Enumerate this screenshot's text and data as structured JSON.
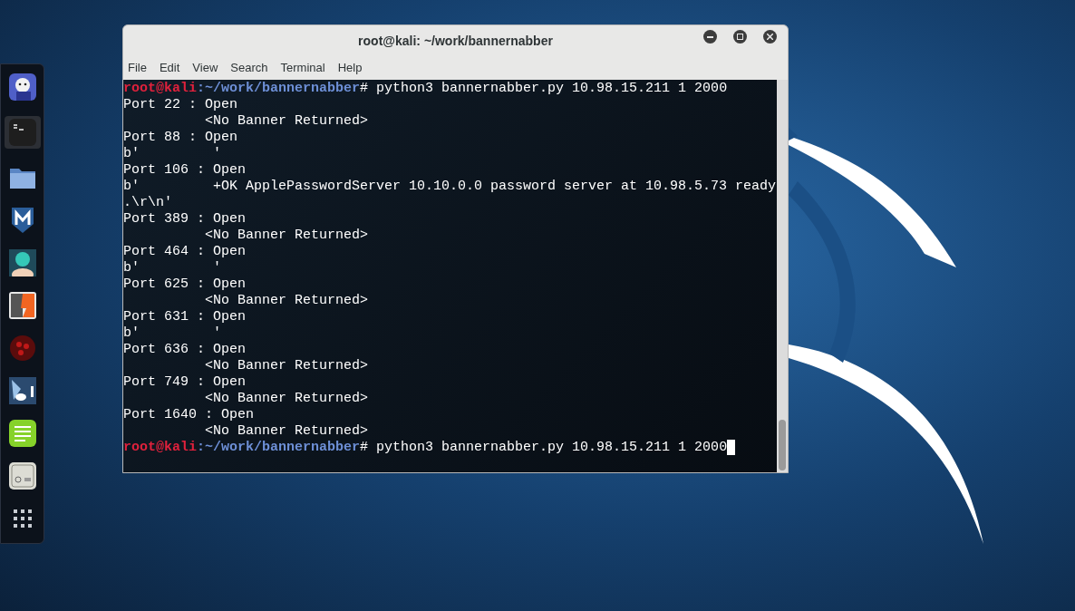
{
  "dock": [
    {
      "kind": "mascot",
      "selected": false
    },
    {
      "kind": "terminal",
      "selected": true
    },
    {
      "kind": "folder",
      "selected": false
    },
    {
      "kind": "shield",
      "selected": false
    },
    {
      "kind": "avatar",
      "selected": false
    },
    {
      "kind": "bolt",
      "selected": false
    },
    {
      "kind": "dots",
      "selected": false
    },
    {
      "kind": "bull",
      "selected": false
    },
    {
      "kind": "notes",
      "selected": false
    },
    {
      "kind": "panel",
      "selected": false
    },
    {
      "kind": "grid",
      "selected": false
    }
  ],
  "window": {
    "title": "root@kali: ~/work/bannernabber",
    "menu": [
      "File",
      "Edit",
      "View",
      "Search",
      "Terminal",
      "Help"
    ]
  },
  "terminal": {
    "lines": [
      {
        "kind": "prompt",
        "user": "root@kali",
        "path": ":~/work/bannernabber",
        "symbol": "#",
        "command": " python3 bannernabber.py 10.98.15.211 1 2000",
        "cursor": false
      },
      {
        "kind": "output",
        "text": "Port 22 : Open"
      },
      {
        "kind": "output",
        "text": "          <No Banner Returned>"
      },
      {
        "kind": "output",
        "text": "Port 88 : Open"
      },
      {
        "kind": "output",
        "text": "b'         '"
      },
      {
        "kind": "output",
        "text": "Port 106 : Open"
      },
      {
        "kind": "output",
        "text": "b'         +OK ApplePasswordServer 10.10.0.0 password server at 10.98.5.73 ready"
      },
      {
        "kind": "output",
        "text": ".\\r\\n'"
      },
      {
        "kind": "output",
        "text": "Port 389 : Open"
      },
      {
        "kind": "output",
        "text": "          <No Banner Returned>"
      },
      {
        "kind": "output",
        "text": "Port 464 : Open"
      },
      {
        "kind": "output",
        "text": "b'         '"
      },
      {
        "kind": "output",
        "text": "Port 625 : Open"
      },
      {
        "kind": "output",
        "text": "          <No Banner Returned>"
      },
      {
        "kind": "output",
        "text": "Port 631 : Open"
      },
      {
        "kind": "output",
        "text": "b'         '"
      },
      {
        "kind": "output",
        "text": "Port 636 : Open"
      },
      {
        "kind": "output",
        "text": "          <No Banner Returned>"
      },
      {
        "kind": "output",
        "text": "Port 749 : Open"
      },
      {
        "kind": "output",
        "text": "          <No Banner Returned>"
      },
      {
        "kind": "output",
        "text": "Port 1640 : Open"
      },
      {
        "kind": "output",
        "text": "          <No Banner Returned>"
      },
      {
        "kind": "prompt",
        "user": "root@kali",
        "path": ":~/work/bannernabber",
        "symbol": "#",
        "command": " python3 bannernabber.py 10.98.15.211 1 2000",
        "cursor": true
      }
    ]
  }
}
